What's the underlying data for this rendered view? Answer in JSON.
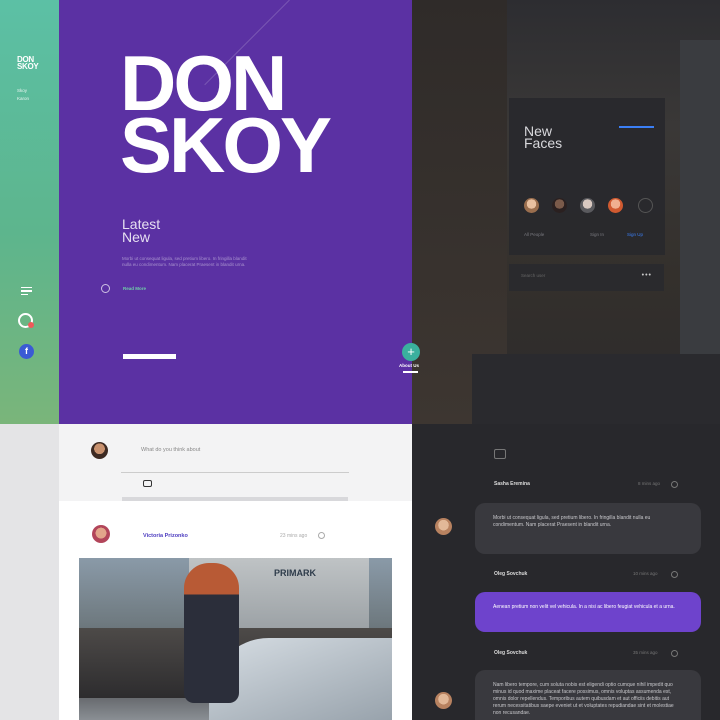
{
  "rail": {
    "brand_line1": "DON",
    "brand_line2": "SKOY",
    "sub_line1": "Skoy",
    "sub_line2": "Karon",
    "menu_icon": "menu-icon",
    "chat_icon": "chat-bubble-icon",
    "facebook_glyph": "f"
  },
  "hero": {
    "title_line1": "DON",
    "title_line2": "SKOY",
    "latest_line1": "Latest",
    "latest_line2": "New",
    "body": "Morbi ut consequat ligula, sed pretium libero. In fringilla blandit nulla eu condimentum. Nam placerat Praesent in blandit urna.",
    "read_more": "Read More",
    "colors": {
      "background": "#5b31a3",
      "accent_green": "#6fd0a8"
    }
  },
  "new_faces": {
    "title_line1": "New",
    "title_line2": "Faces",
    "people": "All People",
    "sign_in": "Sign In",
    "sign_up": "Sign Up",
    "search_placeholder": "Search user",
    "more": "•••",
    "accent": "#3b7ff5"
  },
  "fab": {
    "glyph": "+",
    "label": "About Us",
    "color": "#3ab09e"
  },
  "composer": {
    "placeholder": "What do you think about",
    "camera_icon": "camera-icon"
  },
  "post": {
    "author": "Victoria Prizonko",
    "time": "23 mins ago",
    "image_sign": "PRIMARK"
  },
  "chat": {
    "messages": [
      {
        "name": "Sasha Eremina",
        "time": "8 mins ago",
        "text": "Morbi ut consequat ligula, sed pretium libero. In fringilla blandit nulla eu condimentum. Nam placerat Praesent in blandit urna."
      },
      {
        "name": "Oleg Sovchuk",
        "time": "10 mins ago",
        "text": "Aenean pretium non velit vel vehicula. In a nisi ac libero feugiat vehicula et a urna."
      },
      {
        "name": "Oleg Sovchuk",
        "time": "35 mins ago",
        "text": "Nam libero tempore, cum soluta nobis est eligendi optio cumque nihil impedit quo minus id quod maxime placeat facere possimus, omnis voluptas assumenda est, omnis dolor repellendus. Temporibus autem quibusdam et aut officiis debitis aut rerum necessitatibus saepe eveniet ut et voluptates repudiandae sint et molestiae non recusandae."
      }
    ],
    "purple": "#6e43cc"
  }
}
